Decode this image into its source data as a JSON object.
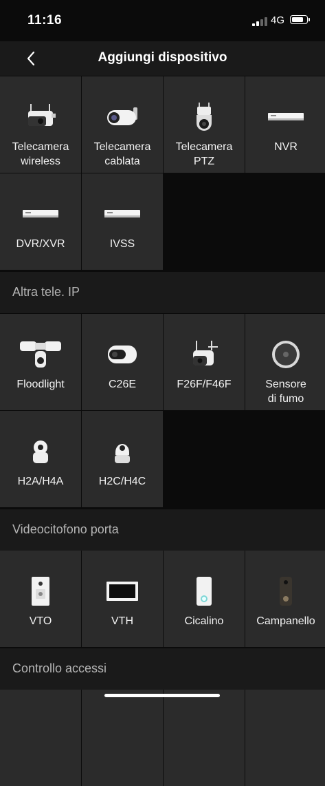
{
  "status_bar": {
    "time": "11:16",
    "network": "4G",
    "signal_bars": 2,
    "battery_level": 0.85
  },
  "header": {
    "title": "Aggiungi dispositivo"
  },
  "sections": {
    "main": {
      "items": [
        {
          "label": "Telecamera\nwireless",
          "icon": "wireless-camera-icon"
        },
        {
          "label": "Telecamera\ncablata",
          "icon": "bullet-camera-icon"
        },
        {
          "label": "Telecamera\nPTZ",
          "icon": "ptz-camera-icon"
        },
        {
          "label": "NVR",
          "icon": "nvr-recorder-icon"
        },
        {
          "label": "DVR/XVR",
          "icon": "dvr-recorder-icon"
        },
        {
          "label": "IVSS",
          "icon": "ivss-recorder-icon"
        }
      ]
    },
    "ip": {
      "title": "Altra tele. IP",
      "items": [
        {
          "label": "Floodlight",
          "icon": "floodlight-camera-icon"
        },
        {
          "label": "C26E",
          "icon": "bullet-camera-icon"
        },
        {
          "label": "F26F/F46F",
          "icon": "wireless-camera-icon"
        },
        {
          "label": "Sensore\ndi fumo",
          "icon": "smoke-sensor-icon"
        },
        {
          "label": "H2A/H4A",
          "icon": "indoor-camera-icon"
        },
        {
          "label": "H2C/H4C",
          "icon": "pan-tilt-camera-icon"
        }
      ]
    },
    "intercom": {
      "title": "Videocitofono porta",
      "items": [
        {
          "label": "VTO",
          "icon": "door-station-icon"
        },
        {
          "label": "VTH",
          "icon": "indoor-monitor-icon"
        },
        {
          "label": "Cicalino",
          "icon": "chime-icon"
        },
        {
          "label": "Campanello",
          "icon": "doorbell-icon"
        }
      ]
    },
    "access": {
      "title": "Controllo accessi"
    }
  }
}
